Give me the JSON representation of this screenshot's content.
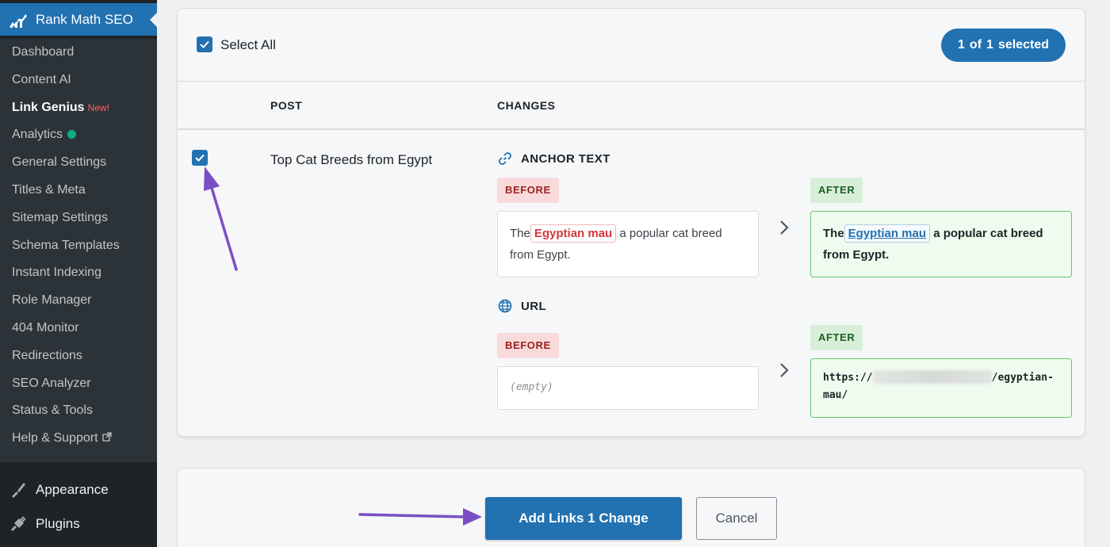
{
  "sidebar": {
    "title": "Rank Math SEO",
    "items": [
      {
        "label": "Dashboard"
      },
      {
        "label": "Content AI"
      },
      {
        "label": "Link Genius",
        "badge": "New!"
      },
      {
        "label": "Analytics"
      },
      {
        "label": "General Settings"
      },
      {
        "label": "Titles & Meta"
      },
      {
        "label": "Sitemap Settings"
      },
      {
        "label": "Schema Templates"
      },
      {
        "label": "Instant Indexing"
      },
      {
        "label": "Role Manager"
      },
      {
        "label": "404 Monitor"
      },
      {
        "label": "Redirections"
      },
      {
        "label": "SEO Analyzer"
      },
      {
        "label": "Status & Tools"
      },
      {
        "label": "Help & Support"
      }
    ],
    "menu": [
      {
        "label": "Appearance"
      },
      {
        "label": "Plugins"
      }
    ]
  },
  "bulk": {
    "select_all": "Select All",
    "count_a": "1",
    "count_of": "of",
    "count_b": "1",
    "count_selected": "selected"
  },
  "table": {
    "col_post": "POST",
    "col_changes": "CHANGES",
    "row": {
      "post_title": "Top Cat Breeds from Egypt",
      "anchor": {
        "heading": "ANCHOR TEXT",
        "before_tag": "BEFORE",
        "after_tag": "AFTER",
        "before_pre": "The",
        "before_hl": "Egyptian mau",
        "before_post": "a popular cat breed from Egypt.",
        "after_pre": "The",
        "after_hl": "Egyptian mau",
        "after_post": "a popular cat breed from Egypt."
      },
      "url": {
        "heading": "URL",
        "before_tag": "BEFORE",
        "after_tag": "AFTER",
        "before_value": "(empty)",
        "after_prefix": "https://",
        "after_suffix": "/egyptian-mau/"
      }
    }
  },
  "actions": {
    "primary": "Add Links 1 Change",
    "cancel": "Cancel"
  },
  "colors": {
    "accent": "#2271b1",
    "sidebar_bg": "#1d2327",
    "annotation_arrow": "#7b4fc4"
  }
}
